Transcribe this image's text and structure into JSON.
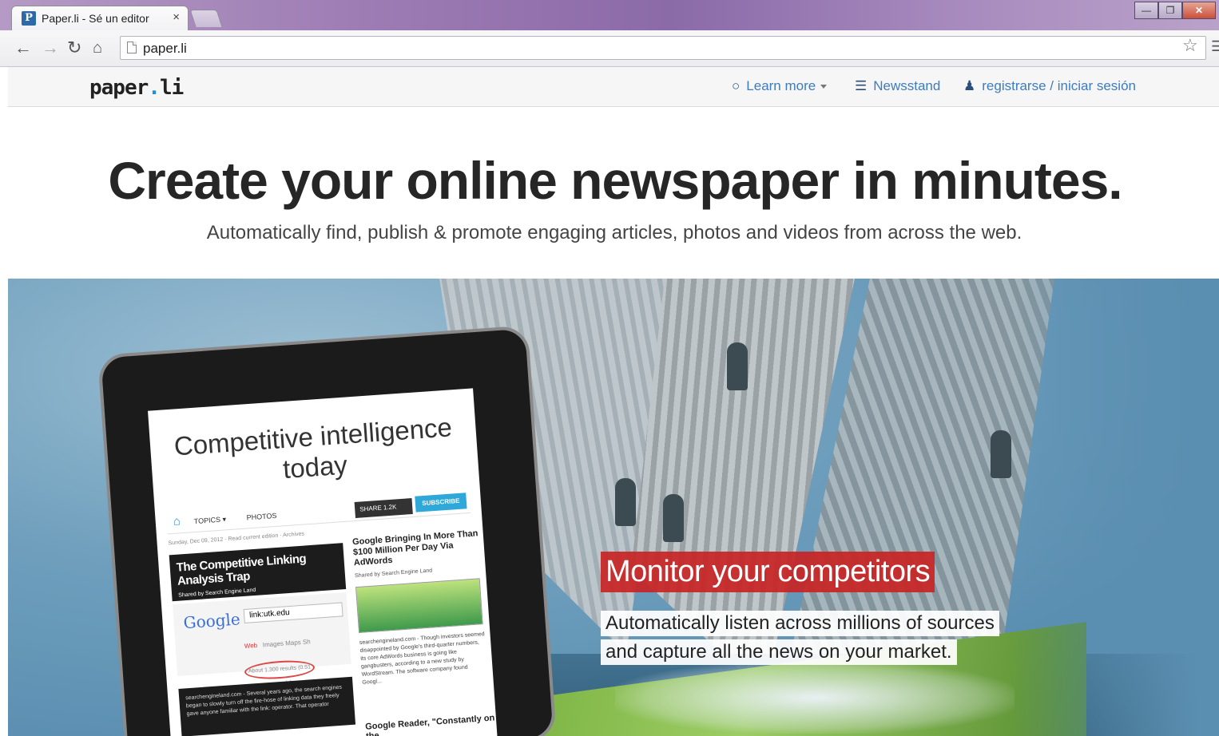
{
  "browser": {
    "tab_title": "Paper.li - Sé un editor",
    "tab_close": "×",
    "favicon": "P",
    "url": "paper.li",
    "window_buttons": [
      "minimize",
      "restore",
      "close"
    ]
  },
  "site": {
    "logo_text": "paper",
    "logo_dot": ".",
    "logo_suffix": "li",
    "nav": {
      "learn_more": "Learn more",
      "newsstand": "Newsstand",
      "login": "registrarse / iniciar sesión"
    }
  },
  "hero": {
    "title": "Create your online newspaper in minutes.",
    "subtitle": "Automatically find, publish & promote engaging articles, photos and videos from across the web."
  },
  "banner": {
    "tablet": {
      "paper_title": "Competitive intelligence today",
      "menu_topics": "TOPICS ▾",
      "menu_photos": "PHOTOS",
      "share": "SHARE 1.2K",
      "subscribe": "SUBSCRIBE",
      "date": "Sunday, Dec 09, 2012 · Read current edition · Archives",
      "article1_title": "The Competitive Linking Analysis Trap",
      "article1_source": "Shared by Search Engine Land",
      "google_logo": "Google",
      "google_query": "link:utk.edu",
      "google_tabs_web": "Web",
      "google_tabs_rest": "Images  Maps  Sh",
      "google_results": "About 1,300 results (0.51 seconds)",
      "article2_title": "Google Bringing In More Than $100 Million Per Day Via AdWords",
      "article2_source": "Shared by Search Engine Land",
      "article2_body": "searchengineland.com - Though investors seemed disappointed by Google's third-quarter numbers, its core AdWords business is going like gangbusters, according to a new study by WordStream. The software company found Googl...",
      "article3_body": "searchengineland.com - Several years ago, the search engines began to slowly turn off the fire-hose of linking data they freely gave anyone familiar with the link: operator. That operator",
      "article4_title": "Google Reader, \"Constantly on the"
    },
    "caption": {
      "headline": "Monitor your competitors",
      "line1": "Automatically listen across millions of sources",
      "line2": "and capture all the news on your market."
    }
  }
}
